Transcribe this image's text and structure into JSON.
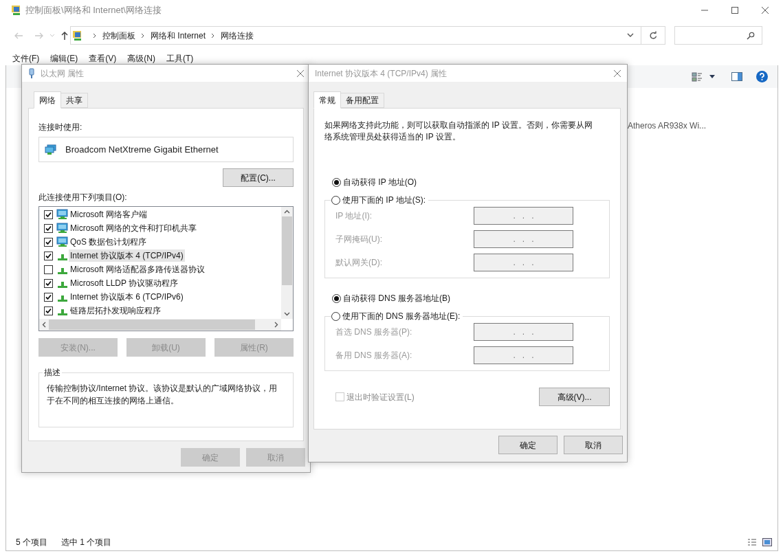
{
  "window": {
    "title": "控制面板\\网络和 Internet\\网络连接"
  },
  "address_bar": {
    "breadcrumbs": [
      "控制面板",
      "网络和 Internet",
      "网络连接"
    ]
  },
  "menu_bar": [
    "文件(F)",
    "编辑(E)",
    "查看(V)",
    "高级(N)",
    "工具(T)"
  ],
  "content": {
    "partial_item_text": "Atheros AR938x Wi..."
  },
  "status_bar": {
    "items": [
      "5 个项目",
      "选中 1 个项目"
    ]
  },
  "ethernet_dialog": {
    "title": "以太网 属性",
    "tabs": [
      {
        "label": "网络",
        "selected": true
      },
      {
        "label": "共享",
        "selected": false
      }
    ],
    "connect_using_label": "连接时使用:",
    "adapter": "Broadcom NetXtreme Gigabit Ethernet",
    "configure_button": "配置(C)...",
    "items_label": "此连接使用下列项目(O):",
    "items": [
      {
        "label": "Microsoft 网络客户端",
        "checked": true,
        "selected": false,
        "kind": "service"
      },
      {
        "label": "Microsoft 网络的文件和打印机共享",
        "checked": true,
        "selected": false,
        "kind": "service"
      },
      {
        "label": "QoS 数据包计划程序",
        "checked": true,
        "selected": false,
        "kind": "service"
      },
      {
        "label": "Internet 协议版本 4 (TCP/IPv4)",
        "checked": true,
        "selected": true,
        "kind": "protocol"
      },
      {
        "label": "Microsoft 网络适配器多路传送器协议",
        "checked": false,
        "selected": false,
        "kind": "protocol"
      },
      {
        "label": "Microsoft LLDP 协议驱动程序",
        "checked": true,
        "selected": false,
        "kind": "protocol"
      },
      {
        "label": "Internet 协议版本 6 (TCP/IPv6)",
        "checked": true,
        "selected": false,
        "kind": "protocol"
      },
      {
        "label": "链路层拓扑发现响应程序",
        "checked": true,
        "selected": false,
        "kind": "protocol"
      }
    ],
    "item_buttons": [
      {
        "label": "安装(N)...",
        "disabled": true
      },
      {
        "label": "卸载(U)",
        "disabled": true
      },
      {
        "label": "属性(R)",
        "disabled": true
      }
    ],
    "description_label": "描述",
    "description": "传输控制协议/Internet 协议。该协议是默认的广域网络协议，用于在不同的相互连接的网络上通信。",
    "footer_buttons": [
      {
        "label": "确定",
        "disabled": true
      },
      {
        "label": "取消",
        "disabled": true
      }
    ]
  },
  "ipv4_dialog": {
    "title": "Internet 协议版本 4 (TCP/IPv4) 属性",
    "tabs": [
      {
        "label": "常规",
        "selected": true
      },
      {
        "label": "备用配置",
        "selected": false
      }
    ],
    "intro": "如果网络支持此功能，则可以获取自动指派的 IP 设置。否则，你需要从网络系统管理员处获得适当的 IP 设置。",
    "groups": [
      {
        "options": [
          {
            "label": "自动获得 IP 地址(O)",
            "selected": true
          },
          {
            "label": "使用下面的 IP 地址(S):",
            "selected": false
          }
        ],
        "fields": [
          {
            "label": "IP 地址(I):",
            "value": ".   .   .",
            "disabled": true
          },
          {
            "label": "子网掩码(U):",
            "value": ".   .   .",
            "disabled": true
          },
          {
            "label": "默认网关(D):",
            "value": ".   .   .",
            "disabled": true
          }
        ]
      },
      {
        "options": [
          {
            "label": "自动获得 DNS 服务器地址(B)",
            "selected": true
          },
          {
            "label": "使用下面的 DNS 服务器地址(E):",
            "selected": false
          }
        ],
        "fields": [
          {
            "label": "首选 DNS 服务器(P):",
            "value": ".   .   .",
            "disabled": true
          },
          {
            "label": "备用 DNS 服务器(A):",
            "value": ".   .   .",
            "disabled": true
          }
        ]
      }
    ],
    "validate_checkbox": {
      "label": "退出时验证设置(L)",
      "checked": false,
      "disabled": true
    },
    "advanced_button": "高级(V)...",
    "footer_buttons": [
      {
        "label": "确定",
        "disabled": false
      },
      {
        "label": "取消",
        "disabled": false
      }
    ]
  }
}
